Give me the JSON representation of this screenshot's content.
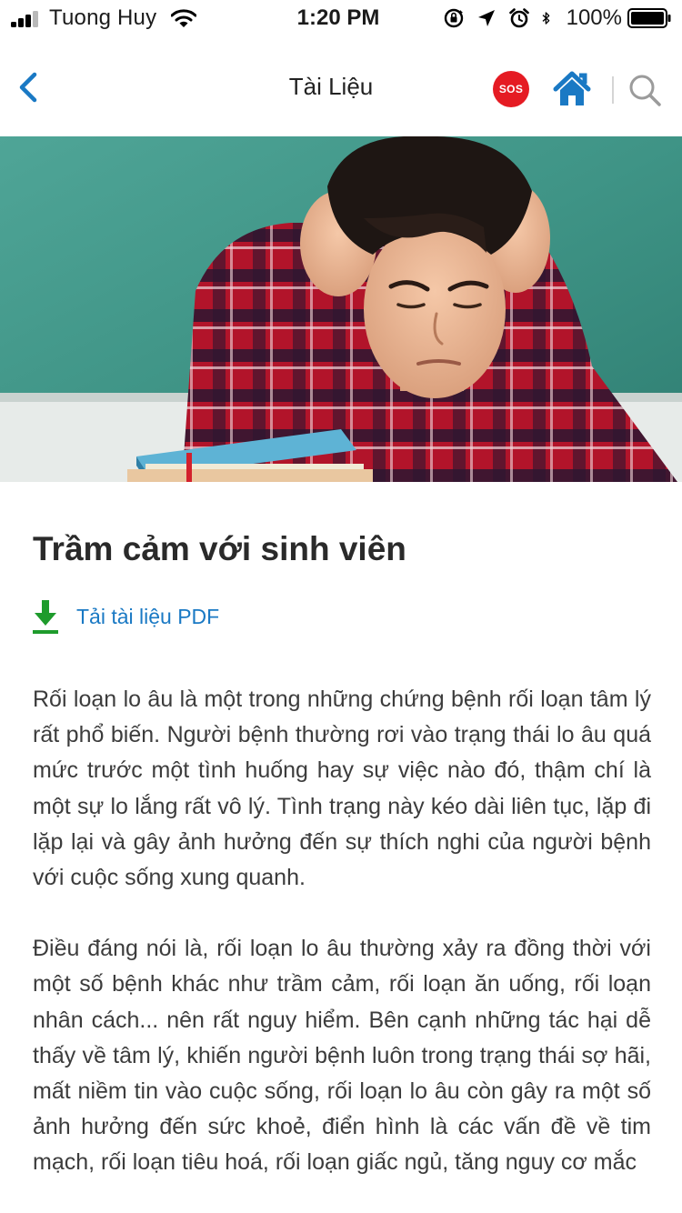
{
  "status_bar": {
    "carrier": "Tuong Huy",
    "time": "1:20 PM",
    "battery_percent": "100%"
  },
  "nav": {
    "title": "Tài Liệu",
    "sos_label": "SOS"
  },
  "article": {
    "title": "Trầm cảm với sinh viên",
    "download_label": "Tải tài liệu PDF",
    "paragraphs": [
      "Rối loạn lo âu là một trong những chứng bệnh rối loạn tâm lý rất phổ biến. Người bệnh thường rơi vào trạng thái lo âu quá mức trước một tình huống hay sự việc nào đó, thậm chí là một sự lo lắng rất vô lý. Tình trạng này kéo dài liên tục, lặp đi lặp lại và gây ảnh hưởng đến sự thích nghi của người bệnh với cuộc sống xung quanh.",
      "Điều đáng nói là, rối loạn lo âu thường xảy ra đồng thời với một số bệnh khác như trầm cảm, rối loạn ăn uống, rối loạn nhân cách... nên rất nguy hiểm. Bên cạnh những tác hại dễ thấy về tâm lý, khiến người bệnh luôn trong trạng thái sợ hãi, mất niềm tin vào cuộc sống, rối loạn lo âu còn gây ra một số ảnh hưởng đến sức khoẻ, điển hình là các vấn đề về tim mạch, rối loạn tiêu hoá, rối loạn giấc ngủ, tăng nguy cơ mắc"
    ]
  },
  "colors": {
    "accent_blue": "#1a79c4",
    "sos_red": "#e51b23",
    "download_green": "#1e9b2c"
  },
  "icons": {
    "back": "chevron-left-icon",
    "home": "home-icon",
    "search": "search-icon",
    "download": "download-arrow-icon"
  }
}
